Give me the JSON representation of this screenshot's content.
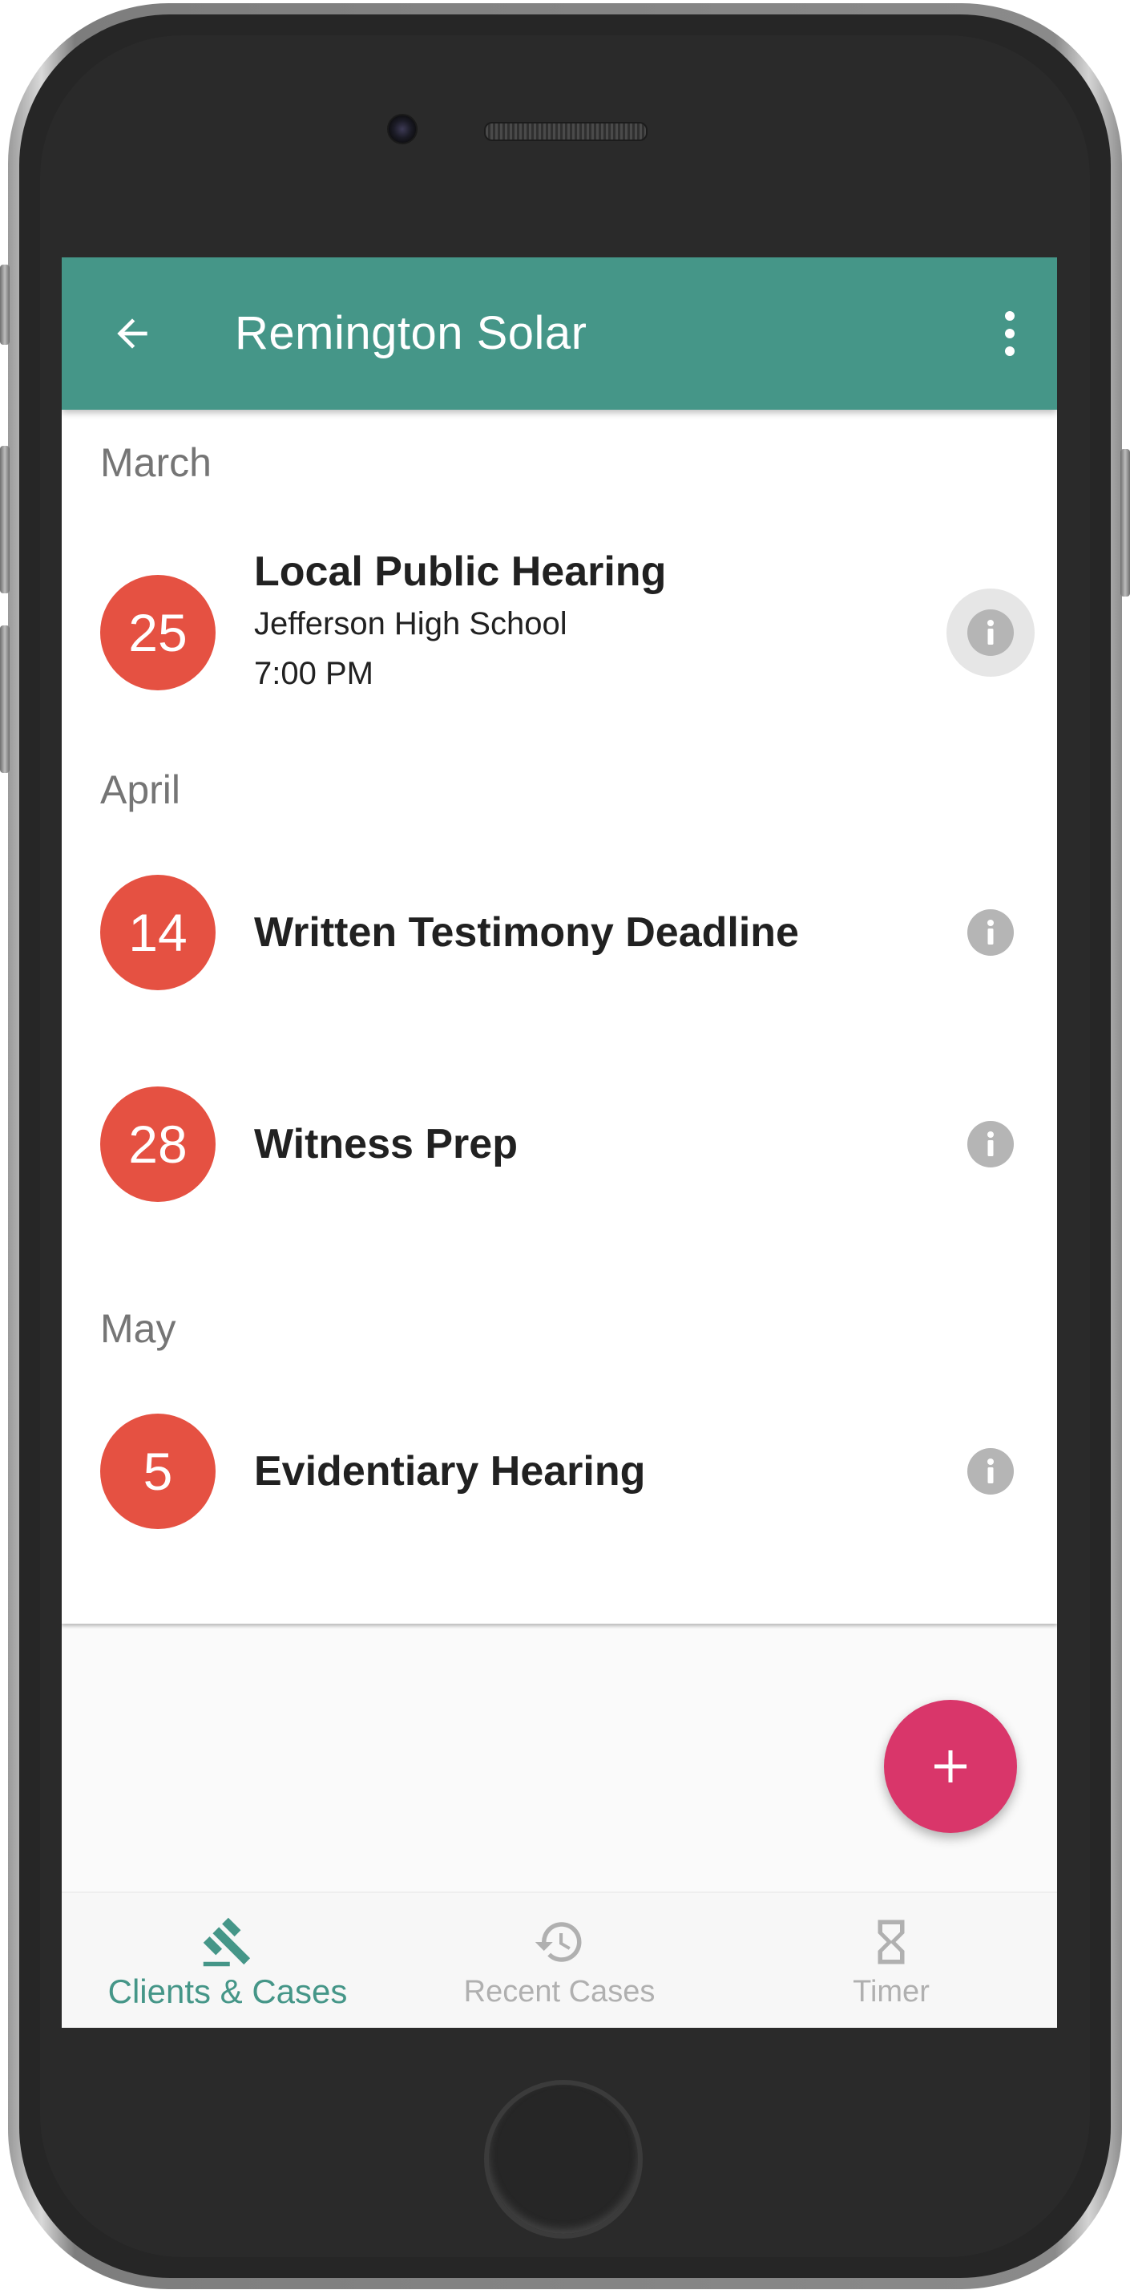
{
  "appbar": {
    "title": "Remington Solar",
    "color": "#459688"
  },
  "sections": [
    {
      "month": "March",
      "events": [
        {
          "day": "25",
          "title": "Local Public Hearing",
          "location": "Jefferson High School",
          "time": "7:00 PM"
        }
      ]
    },
    {
      "month": "April",
      "events": [
        {
          "day": "14",
          "title": "Written Testimony Deadline"
        },
        {
          "day": "28",
          "title": "Witness Prep"
        }
      ]
    },
    {
      "month": "May",
      "events": [
        {
          "day": "5",
          "title": "Evidentiary Hearing"
        }
      ]
    }
  ],
  "bottom_nav": {
    "items": [
      {
        "label": "Clients & Cases",
        "icon": "gavel-icon",
        "active": true
      },
      {
        "label": "Recent Cases",
        "icon": "history-icon",
        "active": false
      },
      {
        "label": "Timer",
        "icon": "hourglass-icon",
        "active": false
      }
    ]
  },
  "colors": {
    "date_circle": "#e55142",
    "fab": "#d9366a",
    "active_nav": "#459688",
    "info_icon": "#b5b5b5"
  },
  "icons": {
    "back": "arrow-back-icon",
    "more": "more-vert-icon",
    "info": "info-icon",
    "fab": "plus-icon"
  }
}
